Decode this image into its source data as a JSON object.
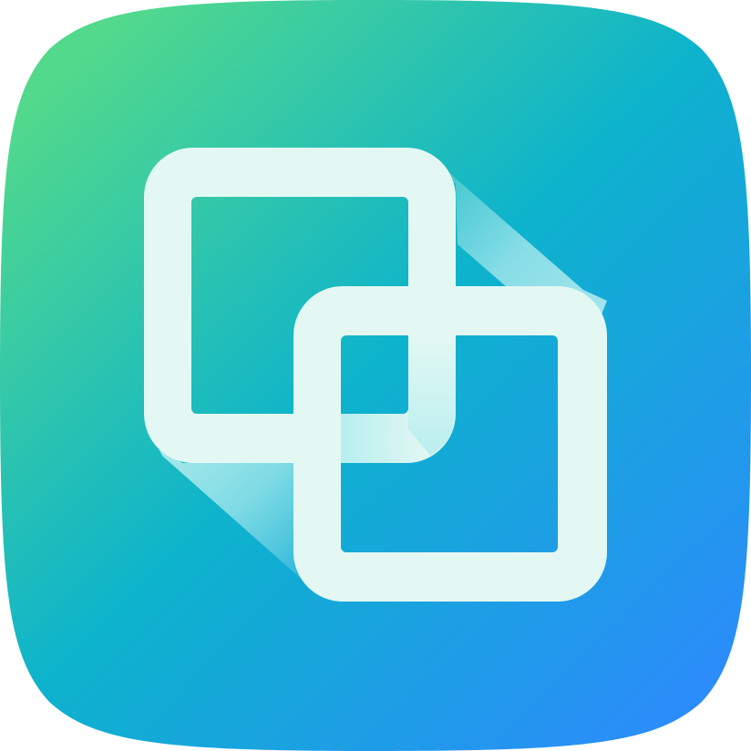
{
  "icon": {
    "name": "overlapping-squares-app-icon",
    "glyph": "two-overlapping-rounded-squares-icon",
    "colors": {
      "gradient_start": "#52D98C",
      "gradient_mid": "#0DB3CC",
      "gradient_end": "#2E88FF",
      "glyph": "#E3F8F3",
      "connector": "#B0ECEF"
    }
  }
}
